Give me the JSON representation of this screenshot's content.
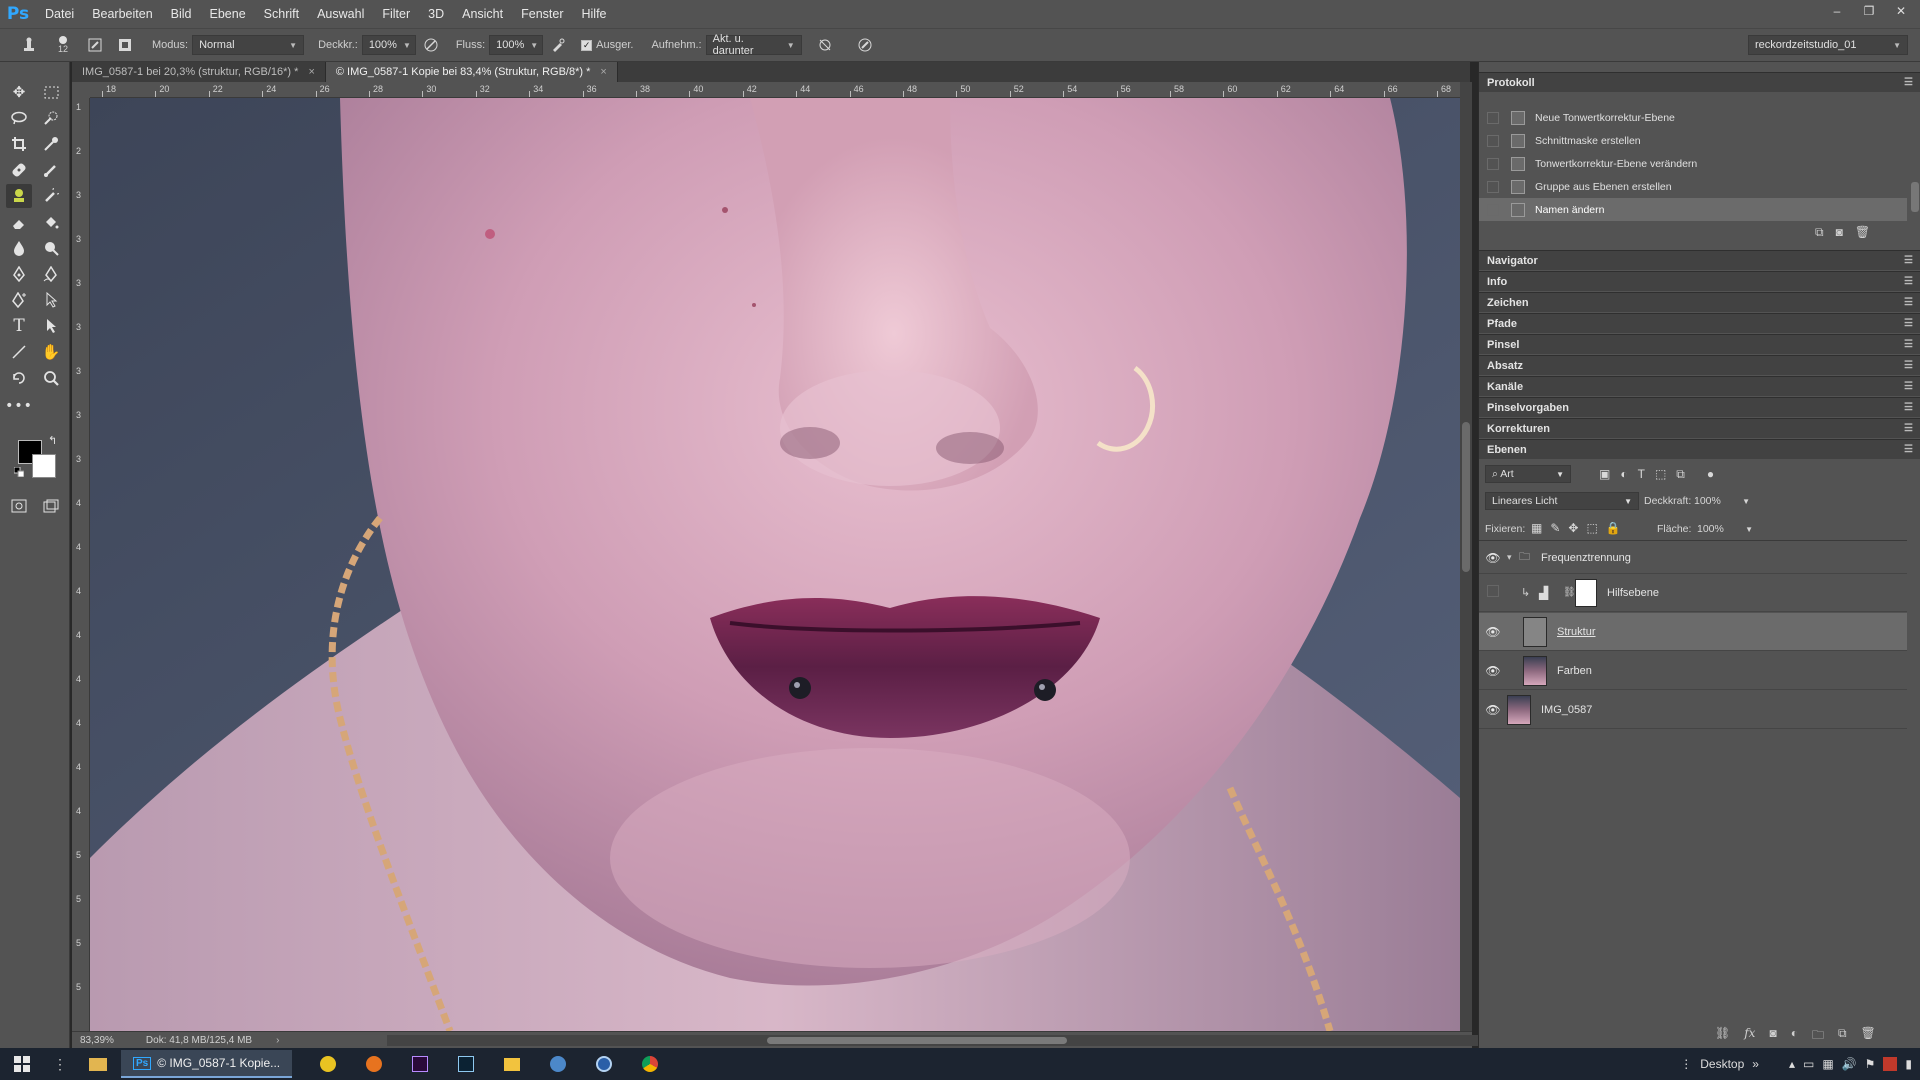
{
  "app": {
    "logo": "Ps"
  },
  "menu": [
    "Datei",
    "Bearbeiten",
    "Bild",
    "Ebene",
    "Schrift",
    "Auswahl",
    "Filter",
    "3D",
    "Ansicht",
    "Fenster",
    "Hilfe"
  ],
  "window_controls": [
    "–",
    "❐",
    "✕"
  ],
  "options": {
    "brush_size": "12",
    "modus_label": "Modus:",
    "modus_value": "Normal",
    "deckkr_label": "Deckkr.:",
    "deckkr_value": "100%",
    "fluss_label": "Fluss:",
    "fluss_value": "100%",
    "ausger_label": "Ausger.",
    "aufnehm_label": "Aufnehm.:",
    "aufnehm_value": "Akt. u. darunter",
    "workspace": "reckordzeitstudio_01"
  },
  "tabs": [
    {
      "label": "IMG_0587-1 bei 20,3% (struktur, RGB/16*) *",
      "close": "×"
    },
    {
      "label": "© IMG_0587-1 Kopie bei 83,4% (Struktur, RGB/8*) *",
      "close": "×"
    }
  ],
  "ruler_top_labels": [
    "18",
    "20",
    "22",
    "24",
    "26",
    "28",
    "30",
    "32",
    "34",
    "36",
    "38",
    "40",
    "42",
    "44",
    "46",
    "48",
    "50",
    "52",
    "54",
    "56",
    "58",
    "60",
    "62",
    "64",
    "66",
    "68"
  ],
  "ruler_left_labels": [
    "1",
    "2",
    "3",
    "3",
    "3",
    "3",
    "3",
    "3",
    "3",
    "4",
    "4",
    "4",
    "4",
    "4",
    "4",
    "4",
    "4",
    "5",
    "5",
    "5",
    "5"
  ],
  "status": {
    "zoom": "83,39%",
    "doc": "Dok: 41,8 MB/125,4 MB"
  },
  "history": {
    "title": "Protokoll",
    "items": [
      {
        "label": "Neue Tonwertkorrektur-Ebene"
      },
      {
        "label": "Schnittmaske erstellen"
      },
      {
        "label": "Tonwertkorrektur-Ebene verändern"
      },
      {
        "label": "Gruppe aus Ebenen erstellen"
      },
      {
        "label": "Namen ändern"
      }
    ]
  },
  "collapsed_panels": [
    "Navigator",
    "Info",
    "Zeichen",
    "Pfade",
    "Pinsel",
    "Absatz",
    "Kanäle",
    "Pinselvorgaben",
    "Korrekturen",
    "Ebenen"
  ],
  "layers_panel": {
    "filter_value": "Art",
    "blend_mode": "Lineares Licht",
    "opacity_label": "Deckkraft:",
    "opacity_value": "100%",
    "fixieren_label": "Fixieren:",
    "flaeche_label": "Fläche:",
    "flaeche_value": "100%",
    "layers": [
      {
        "name": "Frequenztrennung"
      },
      {
        "name": "Hilfsebene"
      },
      {
        "name": "Struktur"
      },
      {
        "name": "Farben"
      },
      {
        "name": "IMG_0587"
      }
    ]
  },
  "taskbar": {
    "active_app": "© IMG_0587-1 Kopie...",
    "desktop_label": "Desktop"
  }
}
